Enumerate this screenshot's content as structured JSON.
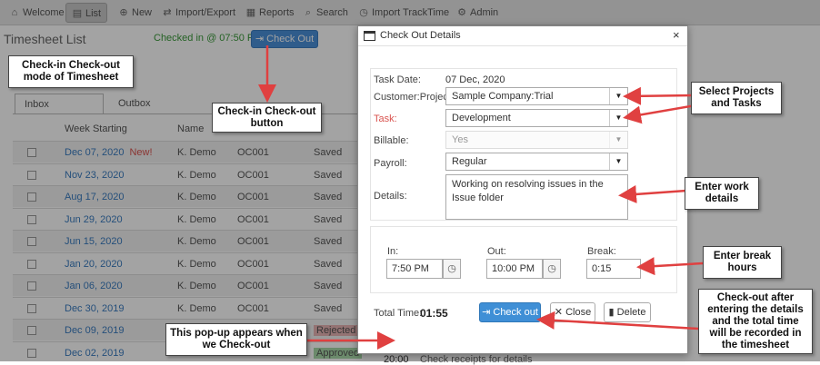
{
  "nav": {
    "items": [
      {
        "icon": "home-icon",
        "glyph": "⌂",
        "label": "Welcome"
      },
      {
        "icon": "document-icon",
        "glyph": "▤",
        "label": "List"
      },
      {
        "icon": "plus-circle-icon",
        "glyph": "⊕",
        "label": "New"
      },
      {
        "icon": "import-export-icon",
        "glyph": "⇄",
        "label": "Import/Export"
      },
      {
        "icon": "chart-icon",
        "glyph": "▦",
        "label": "Reports"
      },
      {
        "icon": "search-icon",
        "glyph": "⌕",
        "label": "Search"
      },
      {
        "icon": "stopwatch-icon",
        "glyph": "◷",
        "label": "Import TrackTime"
      },
      {
        "icon": "gear-icon",
        "glyph": "⚙",
        "label": "Admin"
      }
    ]
  },
  "page": {
    "title": "Timesheet List",
    "checkin_status": "Checked in @ 07:50 PM",
    "checkout_button": "Check Out"
  },
  "tabs": [
    "Inbox",
    "Outbox",
    ""
  ],
  "list": {
    "headers": [
      "Week Starting",
      "Name"
    ],
    "rows": [
      {
        "date": "Dec 07, 2020",
        "badge": "New!",
        "name": "K. Demo",
        "code": "OC001",
        "status": "Saved"
      },
      {
        "date": "Nov 23, 2020",
        "badge": "",
        "name": "K. Demo",
        "code": "OC001",
        "status": "Saved"
      },
      {
        "date": "Aug 17, 2020",
        "badge": "",
        "name": "K. Demo",
        "code": "OC001",
        "status": "Saved"
      },
      {
        "date": "Jun 29, 2020",
        "badge": "",
        "name": "K. Demo",
        "code": "OC001",
        "status": "Saved"
      },
      {
        "date": "Jun 15, 2020",
        "badge": "",
        "name": "K. Demo",
        "code": "OC001",
        "status": "Saved"
      },
      {
        "date": "Jan 20, 2020",
        "badge": "",
        "name": "K. Demo",
        "code": "OC001",
        "status": "Saved"
      },
      {
        "date": "Jan 06, 2020",
        "badge": "",
        "name": "K. Demo",
        "code": "OC001",
        "status": "Saved"
      },
      {
        "date": "Dec 30, 2019",
        "badge": "",
        "name": "K. Demo",
        "code": "OC001",
        "status": "Saved"
      },
      {
        "date": "Dec 09, 2019",
        "badge": "",
        "name": "K. Demo",
        "code": "OC001",
        "status": "Rejected"
      },
      {
        "date": "Dec 02, 2019",
        "badge": "",
        "name": "K. Demo",
        "code": "OC001",
        "status": "Approved"
      }
    ],
    "bottom_hours": "20:00",
    "bottom_note": "Check receipts for details"
  },
  "modal": {
    "title": "Check Out Details",
    "close_glyph": "×",
    "task_date_label": "Task Date:",
    "task_date_value": "07 Dec, 2020",
    "customer_label": "Customer:Project:",
    "customer_value": "Sample Company:Trial",
    "task_label": "Task:",
    "task_value": "Development",
    "billable_label": "Billable:",
    "billable_value": "Yes",
    "payroll_label": "Payroll:",
    "payroll_value": "Regular",
    "details_label": "Details:",
    "details_value": "Working on resolving issues in the Issue folder",
    "in_label": "In:",
    "in_value": "7:50 PM",
    "out_label": "Out:",
    "out_value": "10:00 PM",
    "break_label": "Break:",
    "break_value": "0:15",
    "total_label": "Total Time:",
    "total_value": "01:55",
    "checkout_button": "Check out",
    "close_button": "Close",
    "delete_button": "Delete"
  },
  "callouts": {
    "mode": "Check-in Check-out mode of Timesheet",
    "button": "Check-in Check-out button",
    "popup": "This pop-up appears when we Check-out",
    "projects": "Select Projects and Tasks",
    "work": "Enter work details",
    "break": "Enter break hours",
    "checkout": "Check-out after entering the details and the total time will be recorded in the timesheet"
  },
  "colors": {
    "annotation_arrow": "#e04040",
    "primary_button": "#3f8fd6",
    "checked_in_text": "#3a9a3a"
  }
}
